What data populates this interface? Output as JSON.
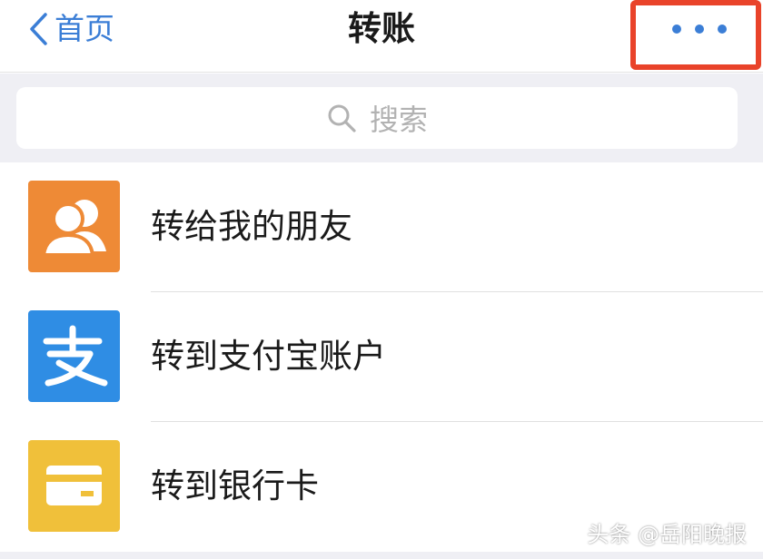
{
  "navbar": {
    "back_label": "首页",
    "title": "转账"
  },
  "search": {
    "placeholder": "搜索"
  },
  "list": {
    "items": [
      {
        "label": "转给我的朋友",
        "icon": "friends-icon",
        "color": "#ee8a36"
      },
      {
        "label": "转到支付宝账户",
        "icon": "alipay-icon",
        "color": "#2f8de4"
      },
      {
        "label": "转到银行卡",
        "icon": "bank-card-icon",
        "color": "#f0c03a"
      }
    ]
  },
  "watermark": "头条 @岳阳晚报",
  "colors": {
    "accent": "#3b7ed6",
    "highlight": "#e9432a",
    "background": "#efeff4"
  }
}
